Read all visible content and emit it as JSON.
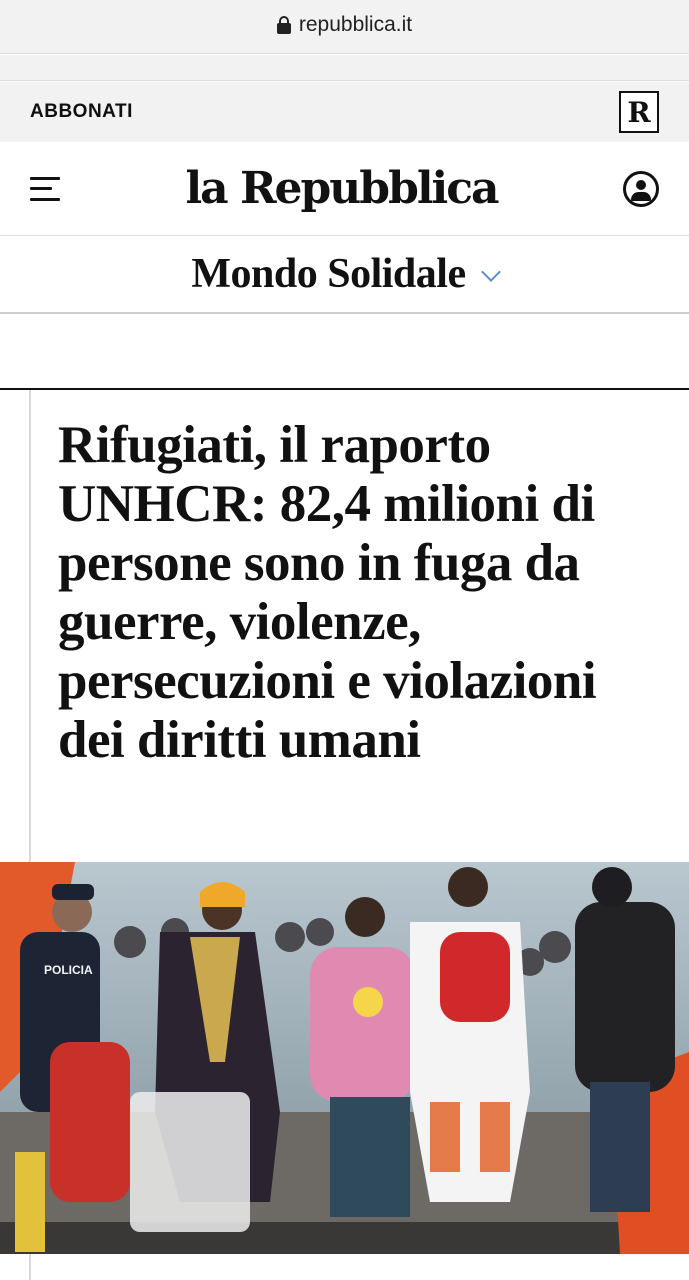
{
  "browser": {
    "url": "repubblica.it"
  },
  "topbar": {
    "subscribe_label": "ABBONATI",
    "logo_letter": "R"
  },
  "header": {
    "brand": "la Repubblica"
  },
  "section": {
    "title": "Mondo Solidale"
  },
  "article": {
    "headline": "Rifugiati, il raporto UNHCR: 82,4 milioni di persone sono in fuga da guerre, violenze, persecuzioni e violazioni dei diritti umani",
    "photo": {
      "vest_text": "POLICIA"
    }
  },
  "colors": {
    "chevron": "#5a8fcf",
    "text": "#111111",
    "bar": "#f2f2f2"
  },
  "icons": [
    "lock-icon",
    "menu-icon",
    "user-icon",
    "chevron-down-icon"
  ]
}
